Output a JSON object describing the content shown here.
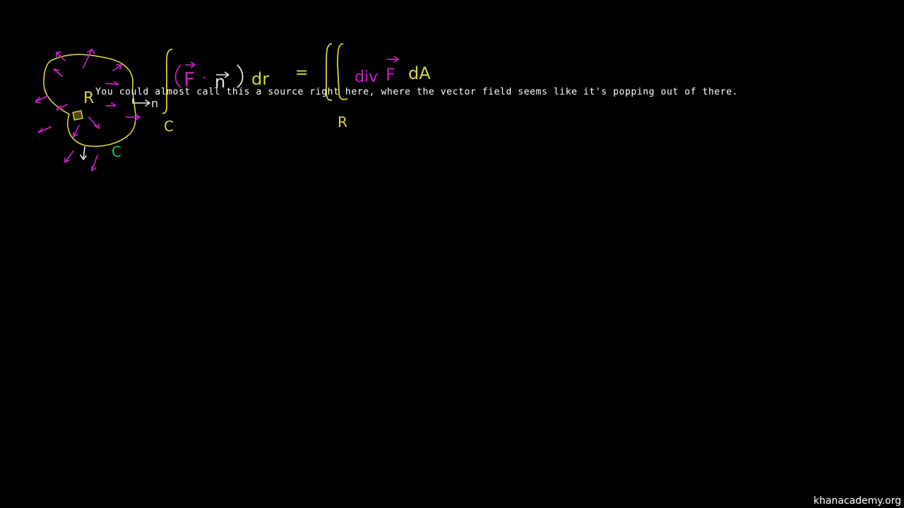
{
  "colors": {
    "background": "#000000",
    "yellow": "#d8d63a",
    "magenta": "#c020c0",
    "white": "#e8e8e8",
    "green": "#22c070"
  },
  "drawing": {
    "region_label": "R",
    "normal_label": "n",
    "curve_label": "C"
  },
  "equation": {
    "vector_f": "F",
    "dot": "·",
    "normal": "n",
    "dr": "dr",
    "equals": "=",
    "div": "div",
    "vector_f2": "F",
    "da": "dA",
    "lhs_bound": "C",
    "rhs_bound": "R"
  },
  "caption": "You could almost call this a source right here, where the vector field seems like it's popping out of there.",
  "watermark": "khanacademy.org"
}
